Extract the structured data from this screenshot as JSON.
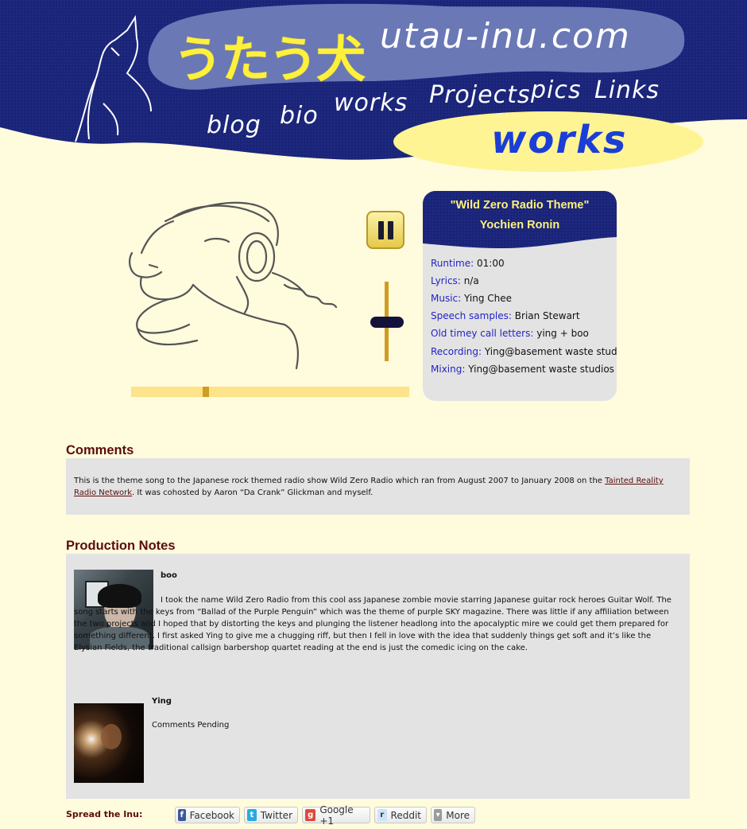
{
  "header": {
    "jp_title": "うたう犬",
    "site_name": "utau-inu.com",
    "nav": [
      {
        "label": "blog"
      },
      {
        "label": "bio"
      },
      {
        "label": "works"
      },
      {
        "label": "Projects"
      },
      {
        "label": "pics"
      },
      {
        "label": "Links"
      }
    ],
    "section_title": "works"
  },
  "player": {
    "pause_icon": "pause-icon",
    "volume_level": 0.5,
    "progress": 0.27
  },
  "track": {
    "title": "\"Wild Zero Radio Theme\"",
    "artist": "Yochien Ronin",
    "credits": [
      {
        "label": "Runtime:",
        "value": "01:00"
      },
      {
        "label": "Lyrics:",
        "value": "n/a"
      },
      {
        "label": "Music:",
        "value": "Ying Chee"
      },
      {
        "label": "Speech samples:",
        "value": "Brian Stewart"
      },
      {
        "label": "Old timey call letters:",
        "value": "ying + boo"
      },
      {
        "label": "Recording:",
        "value": "Ying@basement waste studios"
      },
      {
        "label": "Mixing:",
        "value": "Ying@basement waste studios"
      }
    ]
  },
  "comments": {
    "heading": "Comments",
    "text_before": "This is the theme song to the Japanese rock themed radio show Wild Zero Radio which ran from August 2007 to January 2008 on the ",
    "link": "Tainted Reality Radio Network",
    "text_after": ". It was cohosted by Aaron “Da Crank” Glickman and myself."
  },
  "production": {
    "heading": "Production Notes",
    "notes": [
      {
        "author": "boo",
        "text": "I took the name Wild Zero Radio from this cool ass Japanese zombie movie starring Japanese guitar rock heroes Guitar Wolf. The song starts with the keys from “Ballad of the Purple Penguin” which was the theme of purple SKY magazine. There was little if any affiliation between the two projects and I hoped that by distorting the keys and plunging the listener headlong into the apocalyptic mire we could get them prepared for something different. I first asked Ying to give me a chugging riff, but then I fell in love with the idea that suddenly things get soft and it’s like the Elysian Fields, the traditional callsign barbershop quartet reading at the end is just the comedic icing on the cake."
      },
      {
        "author": "Ying",
        "text": "Comments Pending"
      }
    ]
  },
  "share": {
    "label": "Spread the Inu:",
    "buttons": [
      {
        "label": "Facebook",
        "icon": "facebook-icon",
        "color": "#3b5998"
      },
      {
        "label": "Twitter",
        "icon": "twitter-icon",
        "color": "#2aa9e0"
      },
      {
        "label": "Google +1",
        "icon": "google-plus-icon",
        "color": "#dd4b39"
      },
      {
        "label": "Reddit",
        "icon": "reddit-icon",
        "color": "#cee3f8"
      },
      {
        "label": "More",
        "icon": "more-icon",
        "color": "#9a9a9a"
      }
    ]
  },
  "colors": {
    "background": "#fffbdd",
    "header_navy": "#1a2478",
    "header_blob": "#6b78b6",
    "accent_yellow": "#fff27a",
    "heading_maroon": "#5a0d0d",
    "credit_blue": "#2323c8"
  }
}
